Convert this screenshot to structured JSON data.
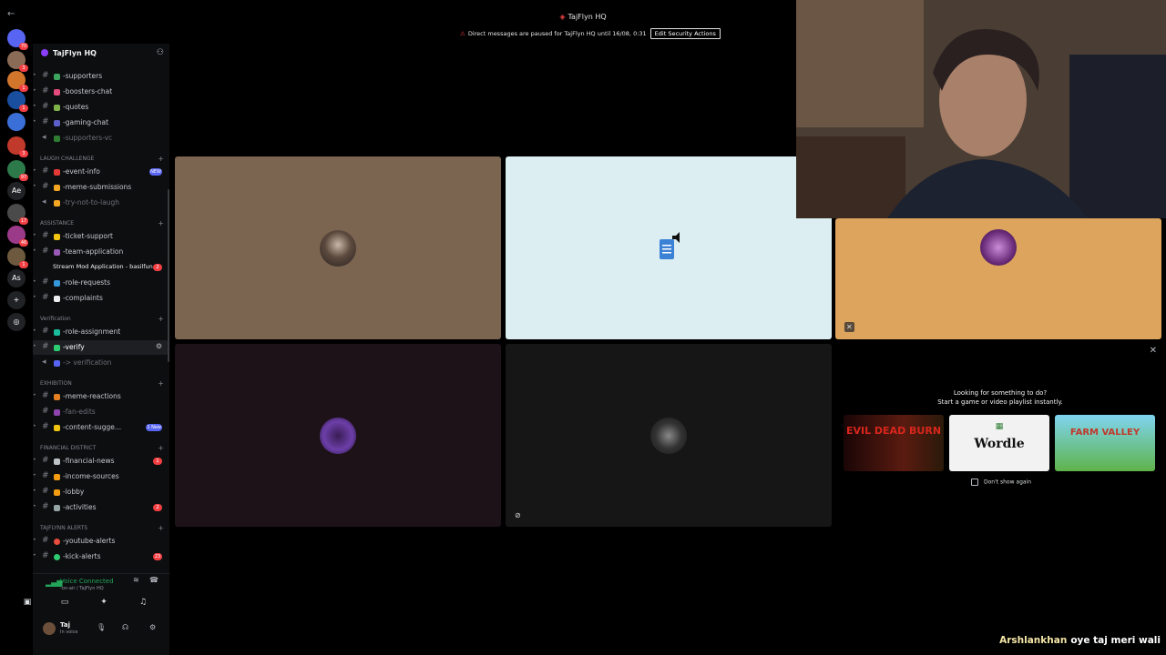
{
  "window": {
    "title": "TajFlyn HQ"
  },
  "banner": {
    "text": "Direct messages are paused for TajFlyn HQ until 16/08, 0:31",
    "button": "Edit Security Actions"
  },
  "server": {
    "name": "TajFlyn HQ"
  },
  "rail_badges": [
    "70",
    "3",
    "1",
    "1",
    "3",
    "97",
    "17",
    "46",
    "1"
  ],
  "rail_text": [
    "Ae",
    "As"
  ],
  "channels_top": [
    {
      "label": "-supporters"
    },
    {
      "label": "-boosters-chat"
    },
    {
      "label": "-quotes"
    },
    {
      "label": "-gaming-chat"
    },
    {
      "label": "-supporters-vc",
      "muted": true
    }
  ],
  "cat_laugh": "LAUGH CHALLENGE",
  "channels_laugh": [
    {
      "label": "-event-info",
      "badge": "NEW"
    },
    {
      "label": "-meme-submissions"
    },
    {
      "label": "-try-not-to-laugh",
      "muted": true
    }
  ],
  "cat_assist": "ASSISTANCE",
  "channels_assist": [
    {
      "label": "-ticket-support"
    },
    {
      "label": "-team-application"
    },
    {
      "label": "Stream Mod Application - basilfun",
      "badge": "2"
    },
    {
      "label": "-role-requests"
    },
    {
      "label": "-complaints"
    }
  ],
  "cat_verif": "Verification",
  "channels_verif": [
    {
      "label": "-role-assignment"
    },
    {
      "label": "-verify"
    },
    {
      "label": "-> verification",
      "muted": true
    }
  ],
  "cat_exhib": "EXHIBITION",
  "channels_exhib": [
    {
      "label": "-meme-reactions"
    },
    {
      "label": "-fan-edits",
      "muted": true
    },
    {
      "label": "-content-sugge...",
      "badge": "1 New"
    }
  ],
  "cat_fin": "FINANCIAL DISTRICT",
  "channels_fin": [
    {
      "label": "-financial-news",
      "badge": "1"
    },
    {
      "label": "-income-sources"
    },
    {
      "label": "-lobby"
    },
    {
      "label": "-activities",
      "badge": "2"
    }
  ],
  "cat_alerts": "TAJFLYNN ALERTS",
  "channels_alerts": [
    {
      "label": "-youtube-alerts"
    },
    {
      "label": "-kick-alerts",
      "badge": "23"
    }
  ],
  "voice": {
    "status": "Voice Connected",
    "channel": "-on-air / TajFlyn HQ"
  },
  "user": {
    "name": "Taj",
    "status": "In voice"
  },
  "activity": {
    "line1": "Looking for something to do?",
    "line2": "Start a game or video playlist instantly.",
    "games": [
      "EVIL DEAD BURN",
      "Wordle",
      "FARM VALLEY"
    ],
    "dont_show": "Don't show again"
  },
  "chat": {
    "user": "Arshlankhan",
    "message": "oye taj meri wali"
  },
  "colors": {
    "tile_brown": "#7b6450",
    "tile_lightblue": "#dceef2",
    "tile_orange": "#dca45c",
    "tile_dark1": "#1d1217",
    "tile_dark2": "#161616",
    "voice_green": "#23a55a"
  }
}
